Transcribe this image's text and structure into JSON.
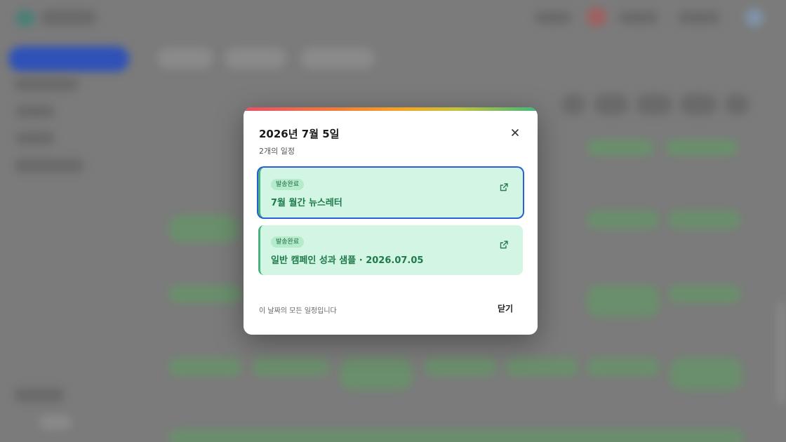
{
  "modal": {
    "title": "2026년 7월 5일",
    "subtitle": "2개의 일정",
    "footnote": "이 날짜의 모든 일정입니다",
    "close_label": "닫기"
  },
  "events": [
    {
      "badge": "발송완료",
      "name": "7월 월간 뉴스레터"
    },
    {
      "badge": "발송완료",
      "name": "일반 캠페인 성과 샘플 · 2026.07.05"
    }
  ],
  "colors": {
    "accent_green": "#49b37f",
    "card_bg": "#d2f6e3",
    "selection_blue": "#2a5ed6"
  },
  "icons": [
    "close-icon",
    "external-link-icon"
  ]
}
